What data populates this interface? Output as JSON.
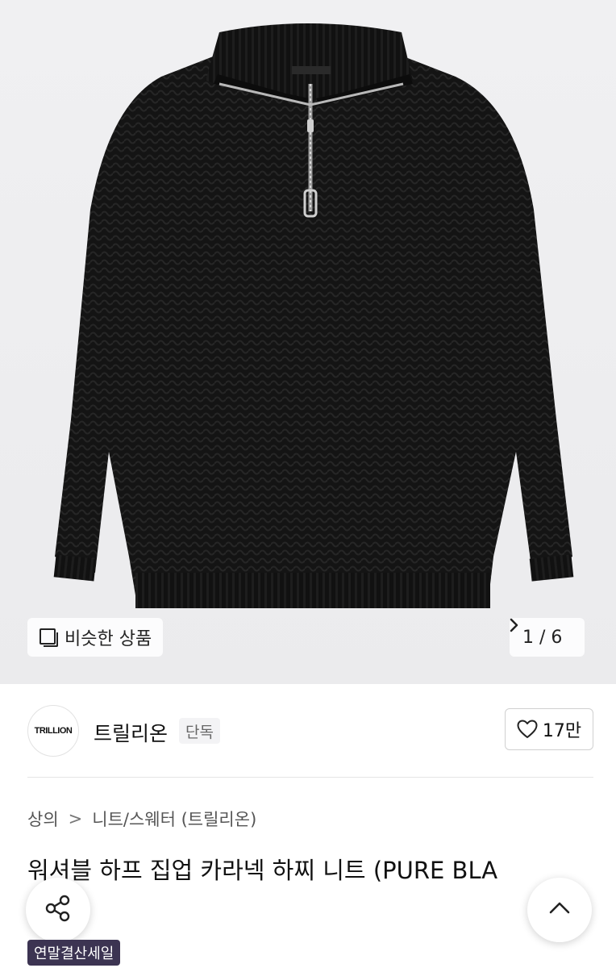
{
  "gallery": {
    "similar_label": "비슷한 상품",
    "page_indicator": "1 / 6",
    "current_index": 1,
    "total": 6
  },
  "brand": {
    "logo_text": "TRILLION",
    "name": "트릴리온",
    "tag": "단독",
    "likes": "17만"
  },
  "breadcrumb": {
    "items": [
      "상의",
      "니트/스웨터 (트릴리온)"
    ],
    "separator": ">"
  },
  "product": {
    "title": "워셔블 하프 집업 카라넥 하찌 니트 (PURE BLA",
    "badge": "연말결산세일"
  },
  "icons": {
    "similar": "similar-items-icon",
    "pager_next": "chevron-right-icon",
    "like": "heart-icon",
    "share": "share-icon",
    "scroll_top": "chevron-up-icon"
  },
  "colors": {
    "badge_bg": "#3c3452",
    "image_bg": "#eeeef0",
    "sweater": "#111111"
  }
}
